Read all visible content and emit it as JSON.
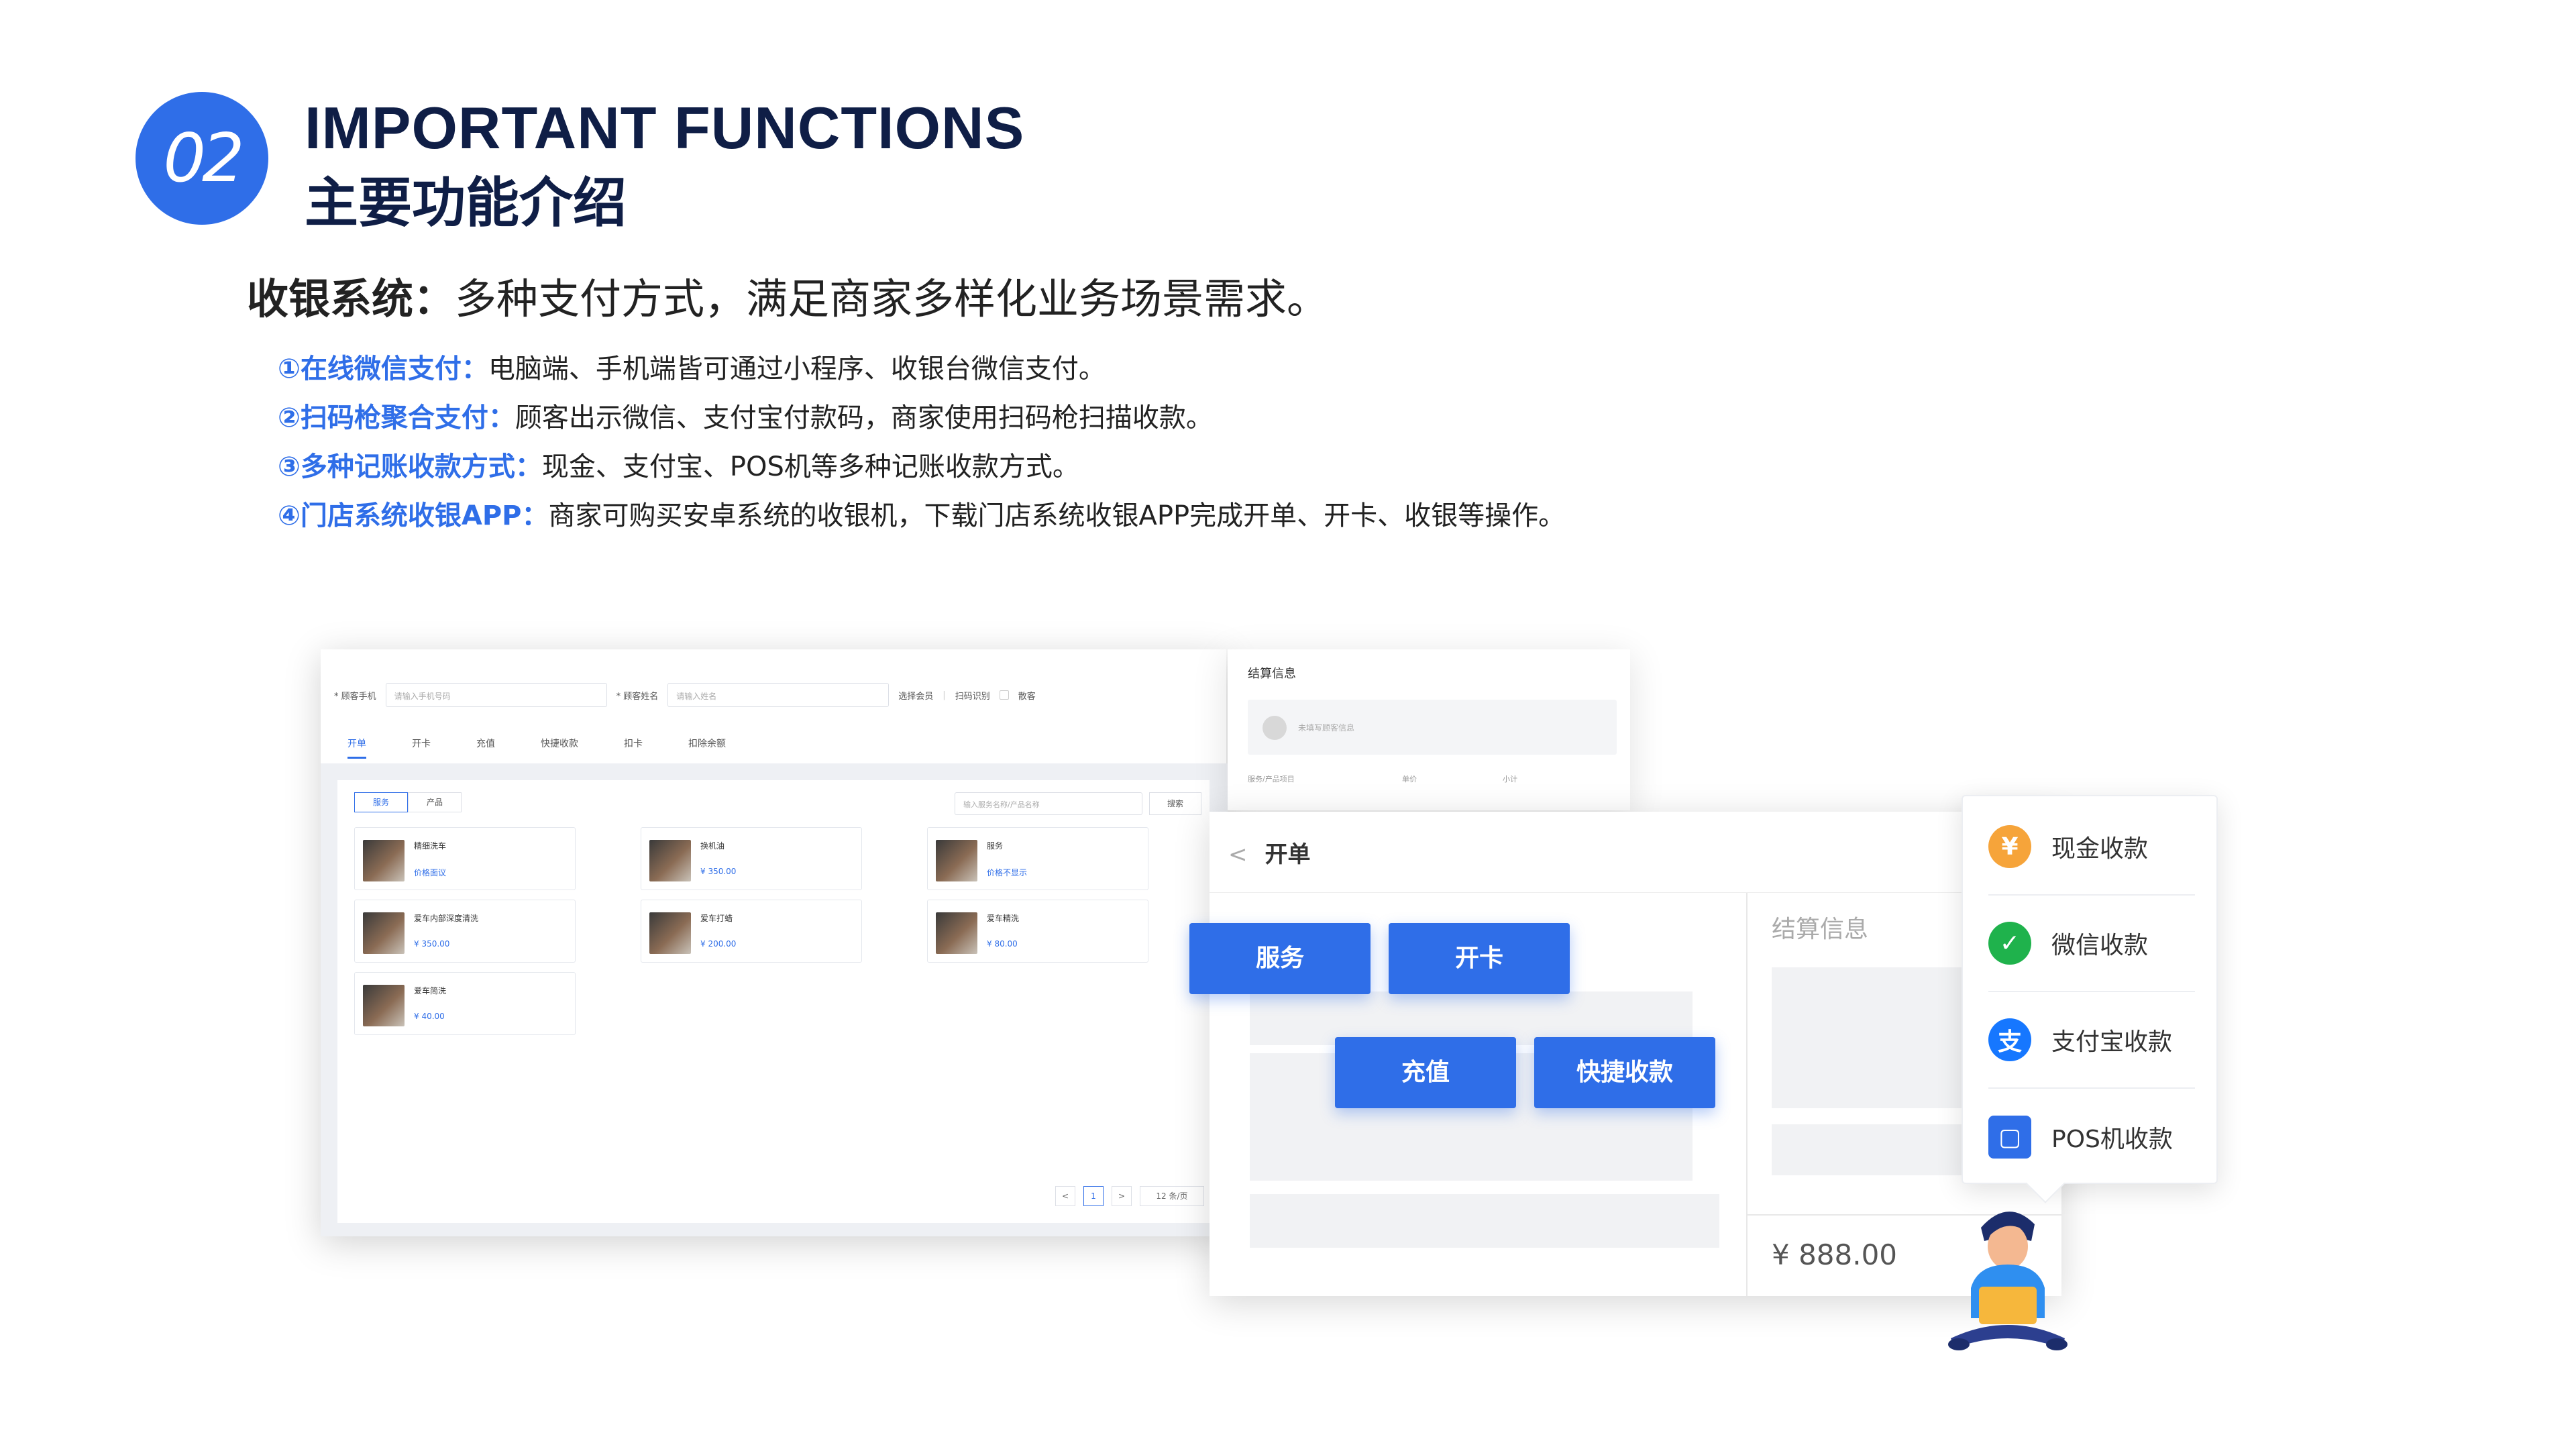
{
  "header": {
    "badge": "02",
    "title_en": "IMPORTANT FUNCTIONS",
    "title_cn": "主要功能介绍"
  },
  "subtitle": {
    "key": "收银系统：",
    "text": "多种支付方式，满足商家多样化业务场景需求。"
  },
  "features": [
    {
      "key": "①在线微信支付：",
      "text": "电脑端、手机端皆可通过小程序、收银台微信支付。"
    },
    {
      "key": "②扫码枪聚合支付：",
      "text": "顾客出示微信、支付宝付款码，商家使用扫码枪扫描收款。"
    },
    {
      "key": "③多种记账收款方式：",
      "text": "现金、支付宝、POS机等多种记账收款方式。"
    },
    {
      "key": "④门店系统收银APP：",
      "text": "商家可购买安卓系统的收银机，下载门店系统收银APP完成开单、开卡、收银等操作。"
    }
  ],
  "back_window": {
    "phone_label": "* 顾客手机",
    "phone_placeholder": "请输入手机号码",
    "name_label": "* 顾客姓名",
    "name_placeholder": "请输入姓名",
    "select_member": "选择会员",
    "scan_card": "扫码识别",
    "walk_in": "散客",
    "tabs": [
      "开单",
      "开卡",
      "充值",
      "快捷收款",
      "扣卡",
      "扣除余额"
    ],
    "seg": [
      "服务",
      "产品"
    ],
    "search_placeholder": "输入服务名称/产品名称",
    "search_btn": "搜索",
    "cards": [
      {
        "name": "精细洗车",
        "price": "价格面议"
      },
      {
        "name": "换机油",
        "price": "¥ 350.00"
      },
      {
        "name": "服务",
        "price": "价格不显示"
      },
      {
        "name": "爱车内部深度清洗",
        "price": "¥ 350.00"
      },
      {
        "name": "爱车打蜡",
        "price": "¥ 200.00"
      },
      {
        "name": "爱车精洗",
        "price": "¥ 80.00"
      },
      {
        "name": "爱车简洗",
        "price": "¥ 40.00"
      }
    ],
    "pager": {
      "prev": "<",
      "page": "1",
      "next": ">",
      "size": "12 条/页"
    },
    "side_title": "结算信息",
    "side_member": "未填写顾客信息",
    "side_cols": [
      "服务/产品项目",
      "单价",
      "小计"
    ]
  },
  "front_window": {
    "back_chevron": "<",
    "title": "开单",
    "right_title": "结算信息",
    "price": "¥ 888.00",
    "buttons": {
      "service": "服务",
      "open_card": "开卡",
      "recharge": "充值",
      "quick_pay": "快捷收款"
    }
  },
  "payment_menu": [
    {
      "label": "现金收款",
      "icon": "yen-icon",
      "glyph": "¥",
      "color": "#f6a43a"
    },
    {
      "label": "微信收款",
      "icon": "wechat-icon",
      "glyph": "✓",
      "color": "#1fb24c"
    },
    {
      "label": "支付宝收款",
      "icon": "alipay-icon",
      "glyph": "支",
      "color": "#1677ff"
    },
    {
      "label": "POS机收款",
      "icon": "pos-icon",
      "glyph": "▢",
      "color": "#2f6ee8"
    }
  ]
}
